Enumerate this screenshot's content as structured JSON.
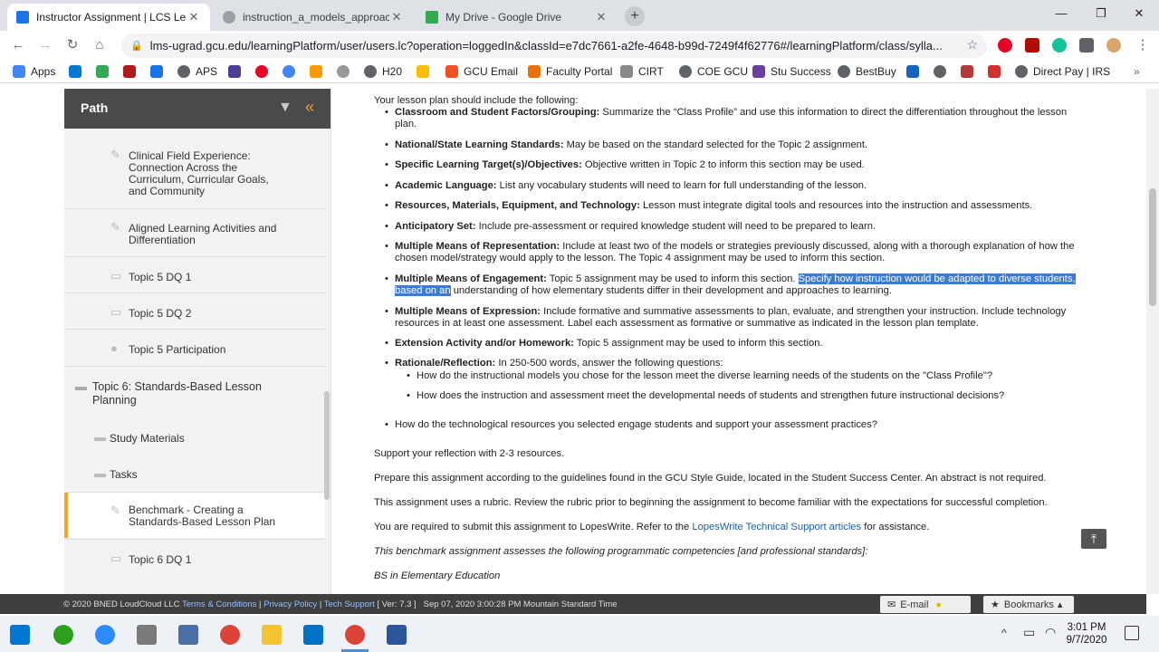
{
  "browser": {
    "tabs": [
      {
        "title": "Instructor Assignment | LCS Lean",
        "active": true,
        "icon_color": "#1a73e8"
      },
      {
        "title": "instruction_a_models_approach_",
        "active": false,
        "icon_color": "#9aa0a6"
      },
      {
        "title": "My Drive - Google Drive",
        "active": false,
        "icon_color": "#34a853"
      }
    ],
    "url": "lms-ugrad.gcu.edu/learningPlatform/user/users.lc?operation=loggedIn&classId=e7dc7661-a2fe-4648-b99d-7249f4f62776#/learningPlatform/class/sylla...",
    "bookmarks": [
      {
        "label": "Apps",
        "color": "#4285f4"
      },
      {
        "label": "",
        "color": "#0078d4"
      },
      {
        "label": "",
        "color": "#34a853"
      },
      {
        "label": "",
        "color": "#b31b1b"
      },
      {
        "label": "",
        "color": "#1a73e8"
      },
      {
        "label": "APS",
        "color": "#5f6368"
      },
      {
        "label": "",
        "color": "#4b3f9a"
      },
      {
        "label": "",
        "color": "#e60023"
      },
      {
        "label": "",
        "color": "#4285f4"
      },
      {
        "label": "",
        "color": "#ff9900"
      },
      {
        "label": "",
        "color": "#999999"
      },
      {
        "label": "H20",
        "color": "#5f6368"
      },
      {
        "label": "",
        "color": "#fbbc04"
      },
      {
        "label": "GCU Email",
        "color": "#f25022"
      },
      {
        "label": "Faculty Portal",
        "color": "#e8710a"
      },
      {
        "label": "CIRT",
        "color": "#888888"
      },
      {
        "label": "COE GCU",
        "color": "#5f6368"
      },
      {
        "label": "Stu Success",
        "color": "#6b3fa0"
      },
      {
        "label": "BestBuy",
        "color": "#5f6368"
      },
      {
        "label": "",
        "color": "#1565c0"
      },
      {
        "label": "",
        "color": "#5f6368"
      },
      {
        "label": "",
        "color": "#b33a3a"
      },
      {
        "label": "",
        "color": "#d32f2f"
      },
      {
        "label": "Direct Pay | IRS",
        "color": "#5f6368"
      }
    ]
  },
  "sidebar": {
    "title": "Path",
    "items": [
      {
        "label": "Clinical Field Experience: Connection Across the Curriculum, Curricular Goals, and Community"
      },
      {
        "label": "Aligned Learning Activities and Differentiation"
      },
      {
        "label": "Topic 5 DQ 1"
      },
      {
        "label": "Topic 5 DQ 2"
      },
      {
        "label": "Topic 5 Participation"
      },
      {
        "label": "Topic 6: Standards-Based Lesson Planning"
      },
      {
        "label": "Study Materials"
      },
      {
        "label": "Tasks"
      },
      {
        "label": "Benchmark - Creating a Standards-Based Lesson Plan"
      },
      {
        "label": "Topic 6 DQ 1"
      }
    ]
  },
  "content": {
    "intro": "Your lesson plan should include the following:",
    "items": [
      {
        "term": "Classroom and Student Factors/Grouping:",
        "text": " Summarize the “Class Profile” and use this information to direct the differentiation throughout the lesson plan."
      },
      {
        "term": "National/State Learning Standards:",
        "text": " May be based on the standard selected for the Topic 2 assignment."
      },
      {
        "term": "Specific Learning Target(s)/Objectives:",
        "text": " Objective written in Topic 2 to inform this section may be used."
      },
      {
        "term": "Academic Language:",
        "text": " List any vocabulary students will need to learn for full understanding of the lesson."
      },
      {
        "term": "Resources, Materials, Equipment, and Technology:",
        "text": " Lesson must integrate digital tools and resources into the instruction and assessments."
      },
      {
        "term": "Anticipatory Set:",
        "text": " Include pre-assessment or required knowledge student will need to be prepared to learn."
      },
      {
        "term": "Multiple Means of Representation:",
        "text": " Include at least two of the models or strategies previously discussed, along with a thorough explanation of how the chosen model/strategy would apply to the lesson. The Topic 4 assignment may be used to inform this section."
      },
      {
        "term": "Multiple Means of Engagement:",
        "text": " Topic 5 assignment may be used to inform this section. ",
        "highlight": "Specify how instruction would be adapted to diverse students, based on an",
        "text_after": " understanding of how elementary students differ in their development and approaches to learning."
      },
      {
        "term": "Multiple Means of Expression:",
        "text": " Include formative and summative assessments to plan, evaluate, and strengthen your instruction. Include technology resources in at least one assessment. Label each assessment as formative or summative as indicated in the lesson plan template."
      },
      {
        "term": "Extension Activity and/or Homework:",
        "text": " Topic 5 assignment may be used to inform this section."
      },
      {
        "term": "Rationale/Reflection:",
        "text": " In 250-500 words, answer the following questions:"
      }
    ],
    "subitems": [
      "How do the instructional models you chose for the lesson meet the diverse learning needs of the students on the \"Class Profile\"?",
      "How does the instruction and assessment meet the developmental needs of students and strengthen future instructional decisions?"
    ],
    "tech_question": "How do the technological resources you selected engage students and support your assessment practices?",
    "support": "Support your reflection with 2-3 resources.",
    "prepare": "Prepare this assignment according to the guidelines found in the GCU Style Guide, located in the Student Success Center. An abstract is not required.",
    "rubric": "This assignment uses a rubric. Review the rubric prior to beginning the assignment to become familiar with the expectations for successful completion.",
    "submit_pre": "You are required to submit this assignment to LopesWrite. Refer to the ",
    "submit_link": "LopesWrite Technical Support articles",
    "submit_post": " for assistance.",
    "benchmark": "This benchmark assignment assesses the following programmatic competencies [and professional standards]:",
    "program": "BS in Elementary Education"
  },
  "footer": {
    "copyright": "© 2020 BNED LoudCloud LLC",
    "terms": "Terms & Conditions",
    "privacy": "Privacy Policy",
    "tech": "Tech Support",
    "version": "[ Ver: 7.3 ]",
    "datetime": "Sep 07, 2020 3:00:28 PM Mountain Standard Time",
    "email": "E-mail",
    "bookmarks": "Bookmarks"
  },
  "taskbar": {
    "time": "3:01 PM",
    "date": "9/7/2020"
  }
}
